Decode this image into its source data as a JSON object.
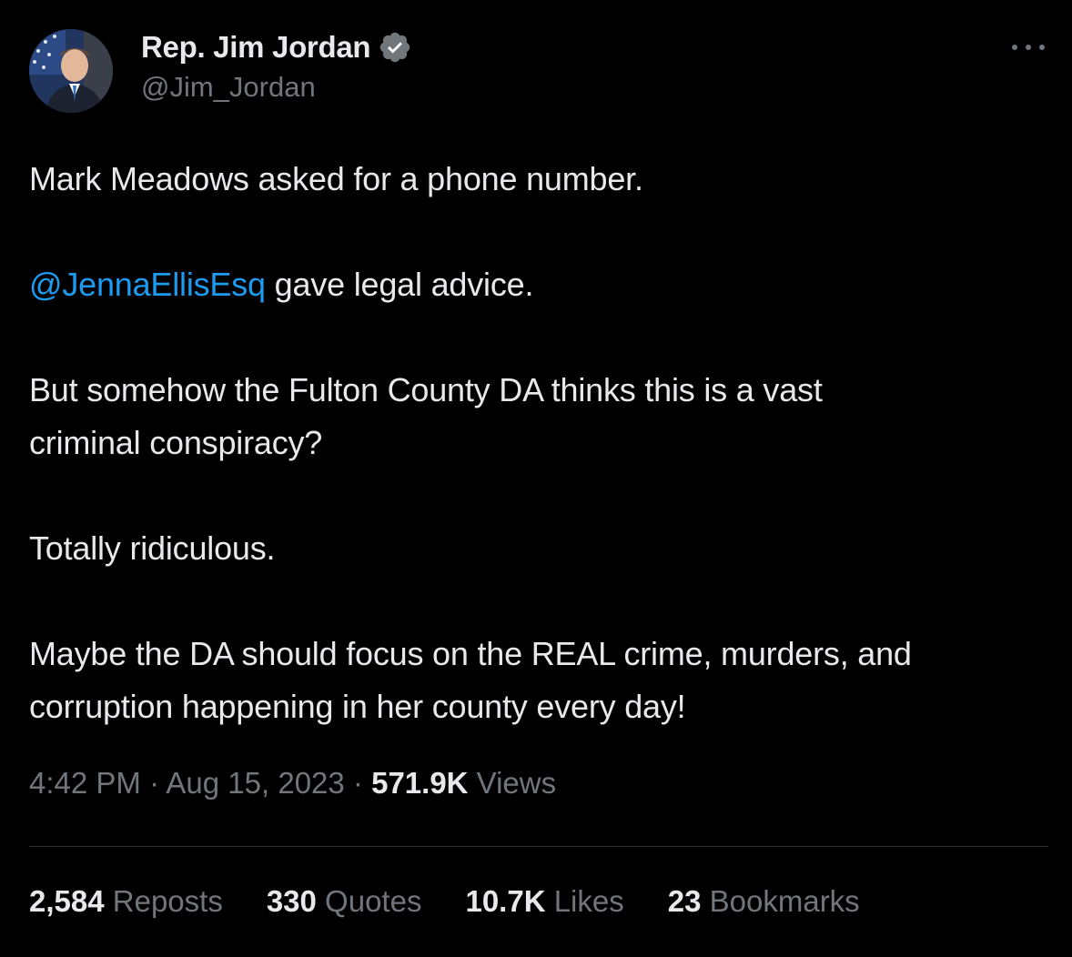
{
  "author": {
    "display_name": "Rep. Jim Jordan",
    "handle": "@Jim_Jordan",
    "verified_badge": "verified-badge-icon",
    "badge_color": "#71767b"
  },
  "tweet": {
    "paragraphs": [
      {
        "text": "Mark Meadows asked for a phone number."
      },
      {
        "mention": "@JennaEllisEsq",
        "text": " gave legal advice."
      },
      {
        "line1": "But somehow the Fulton County DA thinks this is a vast",
        "line2": "criminal conspiracy?"
      },
      {
        "text": "Totally ridiculous."
      },
      {
        "line1": "Maybe the DA should focus on the REAL crime, murders, and",
        "line2": "corruption happening in her county every day!"
      }
    ],
    "mention_color": "#1d9bf0"
  },
  "meta": {
    "time": "4:42 PM",
    "separator": " · ",
    "date": "Aug 15, 2023",
    "views_count": "571.9K",
    "views_label": " Views"
  },
  "stats": {
    "reposts_count": "2,584",
    "reposts_label": " Reposts",
    "quotes_count": "330",
    "quotes_label": " Quotes",
    "likes_count": "10.7K",
    "likes_label": " Likes",
    "bookmarks_count": "23",
    "bookmarks_label": " Bookmarks"
  }
}
